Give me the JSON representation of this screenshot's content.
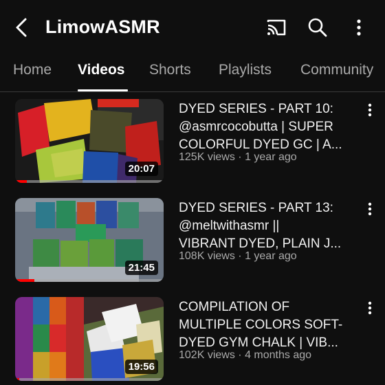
{
  "header": {
    "back_icon": "back-arrow-icon",
    "channel_name": "LimowASMR",
    "cast_icon": "cast-icon",
    "search_icon": "search-icon",
    "more_icon": "more-vert-icon"
  },
  "tabs": [
    {
      "label": "Home",
      "active": false
    },
    {
      "label": "Videos",
      "active": true
    },
    {
      "label": "Shorts",
      "active": false
    },
    {
      "label": "Playlists",
      "active": false
    },
    {
      "label": "Community",
      "active": false
    }
  ],
  "videos": [
    {
      "title_lines": [
        "DYED SERIES - PART 10:",
        "@asmrcocobutta | SUPER",
        "COLORFUL DYED GC | A..."
      ],
      "views": "125K views",
      "age": "1 year ago",
      "separator": "·",
      "duration": "20:07",
      "watched_fraction": 0.08
    },
    {
      "title_lines": [
        "DYED SERIES - PART 13:",
        "@meltwithasmr ||",
        "VIBRANT DYED, PLAIN J..."
      ],
      "views": "108K views",
      "age": "1 year ago",
      "separator": "·",
      "duration": "21:45",
      "watched_fraction": 0.13
    },
    {
      "title_lines": [
        "COMPILATION OF",
        "MULTIPLE COLORS SOFT-",
        "DYED GYM CHALK | VIB..."
      ],
      "views": "102K views",
      "age": "4 months ago",
      "separator": "·",
      "duration": "19:56",
      "watched_fraction": 0.03
    }
  ],
  "colors": {
    "background": "#0f0f0f",
    "text_primary": "#f1f1f1",
    "text_secondary": "#aaaaaa",
    "progress": "#ff0000"
  }
}
